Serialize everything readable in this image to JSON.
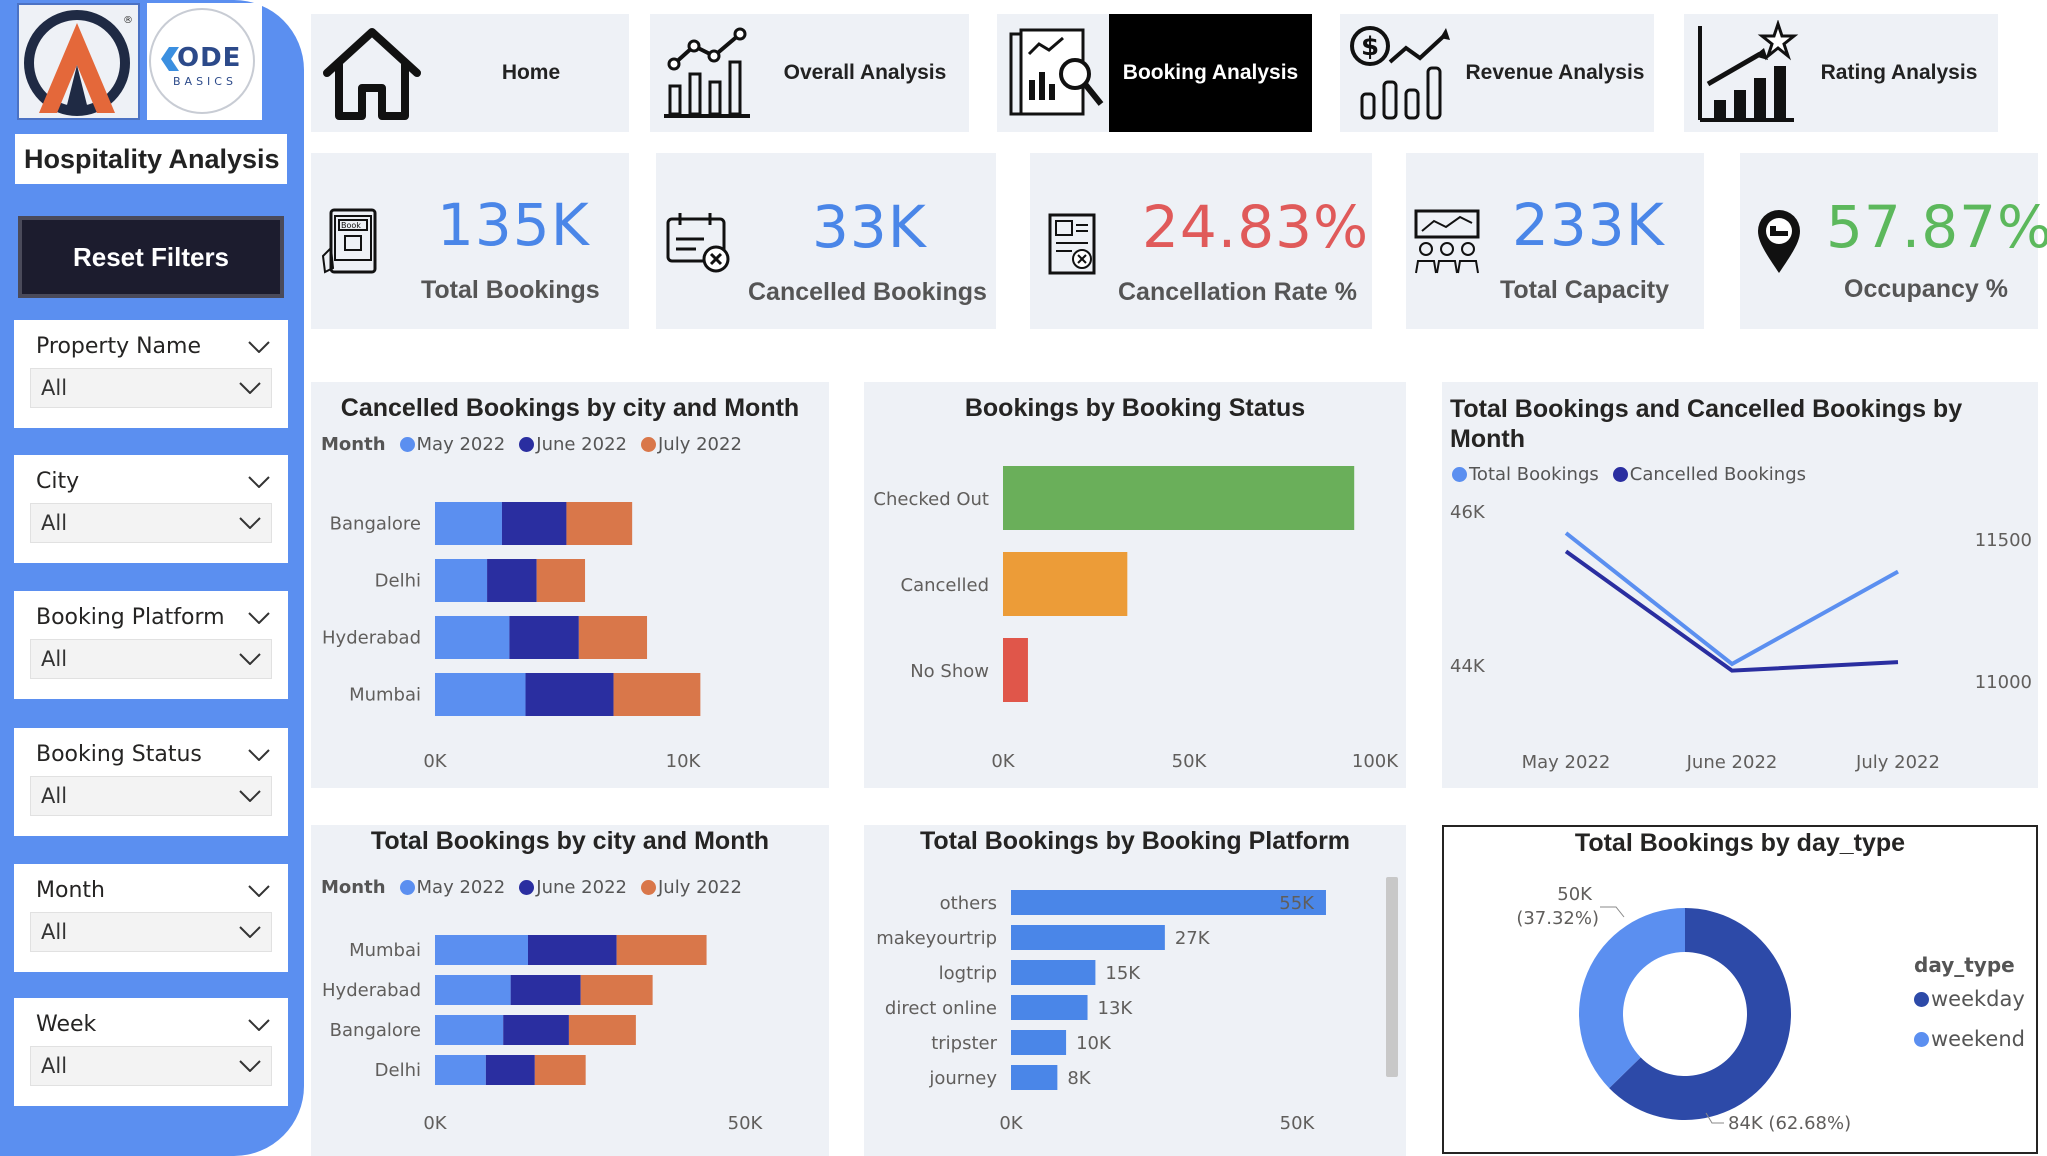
{
  "sidebar": {
    "logo_text": "ODE",
    "logo_sub": "BASICS",
    "title": "Hospitality Analysis",
    "reset_label": "Reset Filters",
    "slicers": [
      {
        "label": "Property Name",
        "value": "All"
      },
      {
        "label": "City",
        "value": "All"
      },
      {
        "label": "Booking Platform",
        "value": "All"
      },
      {
        "label": "Booking Status",
        "value": "All"
      },
      {
        "label": "Month",
        "value": "All"
      },
      {
        "label": "Week",
        "value": "All"
      }
    ]
  },
  "nav": [
    {
      "label": "Home",
      "icon": "home-icon"
    },
    {
      "label": "Overall Analysis",
      "icon": "chart-trend-icon"
    },
    {
      "label": "Booking Analysis",
      "icon": "report-magnifier-icon",
      "active": true
    },
    {
      "label": "Revenue Analysis",
      "icon": "dollar-chart-icon"
    },
    {
      "label": "Rating Analysis",
      "icon": "star-chart-icon"
    }
  ],
  "kpis": [
    {
      "value": "135K",
      "label": "Total Bookings",
      "color": "#4a86e8"
    },
    {
      "value": "33K",
      "label": "Cancelled Bookings",
      "color": "#4a86e8"
    },
    {
      "value": "24.83%",
      "label": "Cancellation Rate %",
      "color": "#e05a5a"
    },
    {
      "value": "233K",
      "label": "Total Capacity",
      "color": "#4a86e8"
    },
    {
      "value": "57.87%",
      "label": "Occupancy %",
      "color": "#5cb85c"
    }
  ],
  "colors": {
    "may": "#5b8ff0",
    "june": "#2a2ea0",
    "july": "#d9774a",
    "green": "#6aaf5a",
    "orange": "#ec9c38",
    "red": "#e0564a",
    "platform": "#4a86e8",
    "weekday": "#2d4aa8",
    "weekend": "#5b8ff0"
  },
  "chart_data": [
    {
      "type": "bar",
      "orientation": "horizontal-stacked",
      "title": "Cancelled Bookings by city and Month",
      "legend_title": "Month",
      "categories": [
        "Bangalore",
        "Delhi",
        "Hyderabad",
        "Mumbai"
      ],
      "series": [
        {
          "name": "May 2022",
          "values": [
            2700,
            2100,
            3000,
            3650
          ]
        },
        {
          "name": "June 2022",
          "values": [
            2600,
            2000,
            2800,
            3550
          ]
        },
        {
          "name": "July 2022",
          "values": [
            2650,
            1950,
            2750,
            3500
          ]
        }
      ],
      "xticks": [
        "0K",
        "10K"
      ],
      "xlim": [
        0,
        10000
      ]
    },
    {
      "type": "bar",
      "orientation": "horizontal",
      "title": "Bookings by Booking Status",
      "categories": [
        "Checked Out",
        "Cancelled",
        "No Show"
      ],
      "values": [
        94411,
        33420,
        6706
      ],
      "xticks": [
        "0K",
        "50K",
        "100K"
      ],
      "xlim": [
        0,
        100000
      ]
    },
    {
      "type": "line",
      "title": "Total Bookings and Cancelled Bookings by Month",
      "categories": [
        "May 2022",
        "June 2022",
        "July 2022"
      ],
      "series": [
        {
          "name": "Total Bookings",
          "axis": "left",
          "values": [
            45700,
            44000,
            45200
          ]
        },
        {
          "name": "Cancelled Bookings",
          "axis": "right",
          "values": [
            11460,
            11040,
            11070
          ]
        }
      ],
      "yticks_left": [
        "46K",
        "44K"
      ],
      "yticks_right": [
        "11500",
        "11000"
      ]
    },
    {
      "type": "bar",
      "orientation": "horizontal-stacked",
      "title": "Total Bookings by city and Month",
      "legend_title": "Month",
      "categories": [
        "Mumbai",
        "Hyderabad",
        "Bangalore",
        "Delhi"
      ],
      "series": [
        {
          "name": "May 2022",
          "values": [
            15000,
            12200,
            11000,
            8200
          ]
        },
        {
          "name": "June 2022",
          "values": [
            14300,
            11300,
            10600,
            7900
          ]
        },
        {
          "name": "July 2022",
          "values": [
            14500,
            11600,
            10800,
            8200
          ]
        }
      ],
      "xticks": [
        "0K",
        "50K"
      ],
      "xlim": [
        0,
        50000
      ]
    },
    {
      "type": "bar",
      "orientation": "horizontal",
      "title": "Total Bookings by Booking Platform",
      "categories": [
        "others",
        "makeyourtrip",
        "logtrip",
        "direct online",
        "tripster",
        "journey"
      ],
      "values": [
        55066,
        26898,
        14756,
        13379,
        9630,
        8106
      ],
      "data_labels": [
        "55K",
        "27K",
        "15K",
        "13K",
        "10K",
        "8K"
      ],
      "xticks": [
        "0K",
        "50K"
      ],
      "xlim": [
        0,
        50000
      ]
    },
    {
      "type": "pie",
      "variant": "donut",
      "title": "Total Bookings by day_type",
      "legend_title": "day_type",
      "categories": [
        "weekday",
        "weekend"
      ],
      "values": [
        84,
        50
      ],
      "data_labels": [
        "84K (62.68%)",
        "50K\n(37.32%)"
      ],
      "label_weekend_1": "50K",
      "label_weekend_2": "(37.32%)",
      "label_weekday": "84K (62.68%)"
    }
  ]
}
